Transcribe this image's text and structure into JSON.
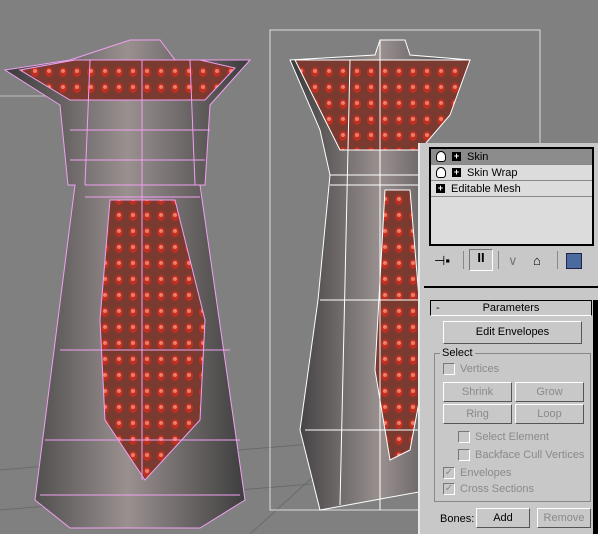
{
  "modifier_stack": {
    "items": [
      {
        "label": "Skin",
        "selected": true,
        "has_bulb": true
      },
      {
        "label": "Skin Wrap",
        "selected": false,
        "has_bulb": true
      },
      {
        "label": "Editable Mesh",
        "selected": false,
        "has_bulb": false
      }
    ]
  },
  "toolbar": {
    "icons": [
      "pin-stack-icon",
      "show-end-result-icon",
      "make-unique-icon",
      "remove-modifier-icon",
      "configure-modifier-sets-icon"
    ]
  },
  "parameters": {
    "title": "Parameters",
    "collapse": "-",
    "edit_envelopes": "Edit Envelopes",
    "select_group": "Select",
    "vertices": {
      "label": "Vertices",
      "checked": false
    },
    "shrink": "Shrink",
    "grow": "Grow",
    "ring": "Ring",
    "loop": "Loop",
    "select_element": {
      "label": "Select Element",
      "checked": false
    },
    "backface_cull": {
      "label": "Backface Cull Vertices",
      "checked": false
    },
    "envelopes": {
      "label": "Envelopes",
      "checked": true
    },
    "cross_sections": {
      "label": "Cross Sections",
      "checked": true
    },
    "bones_label": "Bones:",
    "add": "Add",
    "remove": "Remove"
  },
  "colors": {
    "viewport_bg": "#808080",
    "panel_bg": "#c8c8c8",
    "left_wire": "#f0a0f0",
    "right_wire": "#ffffff"
  }
}
